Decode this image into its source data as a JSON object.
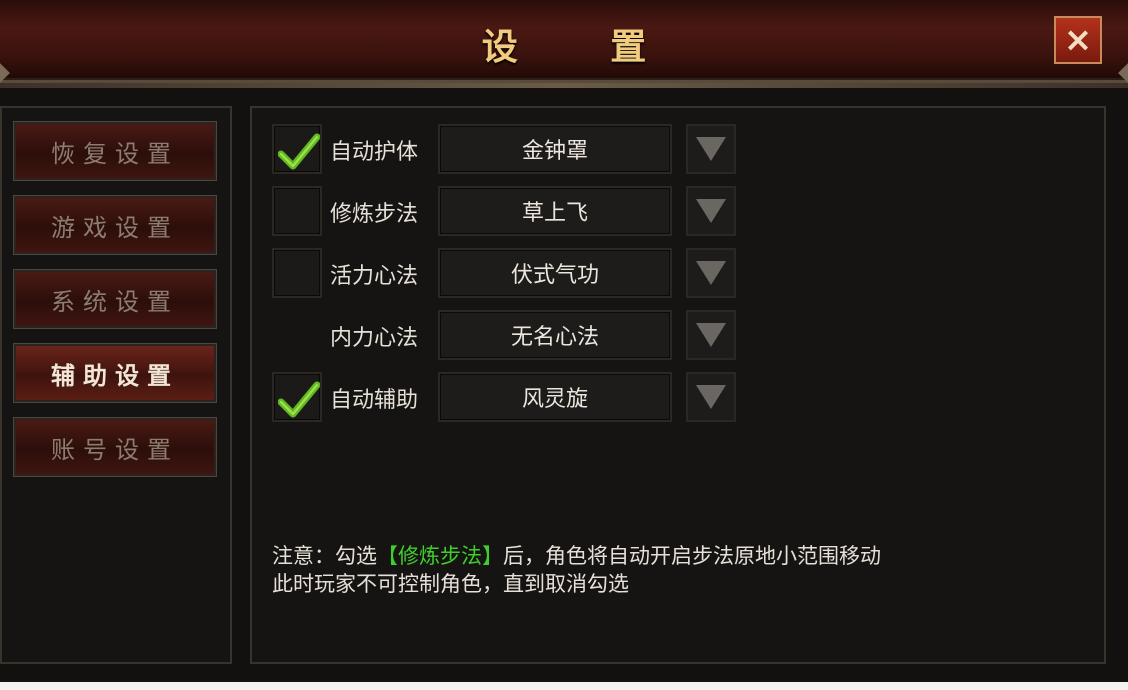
{
  "window": {
    "title": "设 置",
    "close_icon": "×"
  },
  "sidebar": {
    "items": [
      {
        "label": "恢复设置",
        "active": false
      },
      {
        "label": "游戏设置",
        "active": false
      },
      {
        "label": "系统设置",
        "active": false
      },
      {
        "label": "辅助设置",
        "active": true
      },
      {
        "label": "账号设置",
        "active": false
      }
    ]
  },
  "rows": [
    {
      "label": "自动护体",
      "value": "金钟罩",
      "checked": true,
      "has_checkbox": true
    },
    {
      "label": "修炼步法",
      "value": "草上飞",
      "checked": false,
      "has_checkbox": true
    },
    {
      "label": "活力心法",
      "value": "伏式气功",
      "checked": false,
      "has_checkbox": true
    },
    {
      "label": "内力心法",
      "value": "无名心法",
      "checked": false,
      "has_checkbox": false
    },
    {
      "label": "自动辅助",
      "value": "风灵旋",
      "checked": true,
      "has_checkbox": true
    }
  ],
  "note": {
    "prefix": "注意：勾选",
    "highlight": "【修炼步法】",
    "suffix": "后，角色将自动开启步法原地小范围移动",
    "line2": "此时玩家不可控制角色，直到取消勾选"
  },
  "colors": {
    "accent_title": "#f1cc7e",
    "highlight_green": "#3ed02a",
    "check_green": "#5fb820"
  },
  "icons": {
    "checkbox_checked": "check-icon",
    "dropdown": "triangle-down-icon",
    "close": "close-icon"
  }
}
